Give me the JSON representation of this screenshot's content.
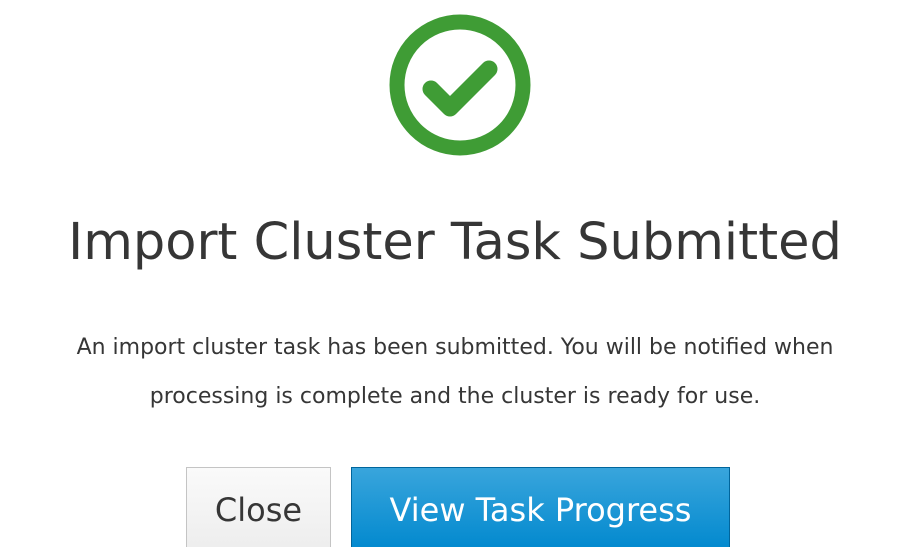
{
  "dialog": {
    "icon": "check-circle-icon",
    "icon_color": "#3f9c35",
    "title": "Import Cluster Task Submitted",
    "message_line1": "An import cluster task has been submitted. You will be notified when",
    "message_line2": "processing is complete and the cluster is ready for use.",
    "close_label": "Close",
    "primary_label": "View Task Progress",
    "primary_color": "#0088ce"
  }
}
